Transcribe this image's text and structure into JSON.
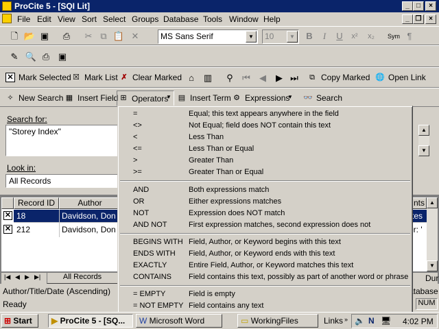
{
  "window": {
    "title": "ProCite 5 - [SQI Lit]"
  },
  "menubar": {
    "items": [
      "File",
      "Edit",
      "View",
      "Sort",
      "Select",
      "Groups",
      "Database",
      "Tools",
      "Window",
      "Help"
    ]
  },
  "format_toolbar": {
    "font_name": "MS Sans Serif",
    "font_size": "10",
    "bold": "B",
    "italic": "I",
    "underline": "U",
    "superscript": "x²",
    "subscript": "x₂",
    "symbol": "Sym",
    "pilcrow": "¶"
  },
  "record_toolbar": {
    "mark_selected": "Mark Selected",
    "mark_list": "Mark List",
    "clear_marked": "Clear Marked",
    "copy_marked": "Copy Marked",
    "open_link": "Open Link"
  },
  "search_toolbar": {
    "new_search": "New Search",
    "insert_field": "Insert Field",
    "operators": "Operators",
    "insert_term": "Insert Term",
    "expressions": "Expressions",
    "search": "Search"
  },
  "search_panel": {
    "search_for_label": "Search for:",
    "search_for_value": "\"Storey Index\"",
    "look_in_label": "Look in:",
    "look_in_value": "All Records"
  },
  "grid": {
    "columns": [
      "Record ID",
      "Author"
    ],
    "right_header_fragment": "nts",
    "rows": [
      {
        "checked": true,
        "id": "18",
        "author": "Davidson, Don",
        "tail": "tes",
        "selected": true
      },
      {
        "checked": true,
        "id": "212",
        "author": "Davidson, Don",
        "tail": "er: '",
        "selected": false
      }
    ],
    "tab_label": "All Records",
    "right_tab_fragment": "Dur"
  },
  "status": {
    "sort_order": "Author/Title/Date (Ascending)",
    "ready": "Ready",
    "database_fragment": "atabase",
    "num": "NUM"
  },
  "operators_menu": {
    "groups": [
      [
        {
          "op": "=",
          "desc": "Equal; this text appears anywhere in the field"
        },
        {
          "op": "<>",
          "desc": "Not Equal; field does NOT contain this text"
        },
        {
          "op": "<",
          "desc": "Less Than"
        },
        {
          "op": "<=",
          "desc": "Less Than or Equal"
        },
        {
          "op": ">",
          "desc": "Greater Than"
        },
        {
          "op": ">=",
          "desc": "Greater Than or Equal"
        }
      ],
      [
        {
          "op": "AND",
          "desc": "Both expressions match"
        },
        {
          "op": "OR",
          "desc": "Either expressions matches"
        },
        {
          "op": "NOT",
          "desc": "Expression does NOT match"
        },
        {
          "op": "AND NOT",
          "desc": "First expression matches, second expression does not"
        }
      ],
      [
        {
          "op": "BEGINS WITH",
          "desc": "Field, Author, or Keyword begins with this text"
        },
        {
          "op": "ENDS WITH",
          "desc": "Field, Author, or Keyword ends with this text"
        },
        {
          "op": "EXACTLY",
          "desc": "Entire Field, Author, or Keyword matches this text"
        },
        {
          "op": "CONTAINS",
          "desc": "Field contains this text, possibly as part of another word or phrase"
        }
      ],
      [
        {
          "op": "= EMPTY",
          "desc": "Field is empty"
        },
        {
          "op": "= NOT EMPTY",
          "desc": "Field contains any text"
        }
      ]
    ]
  },
  "taskbar": {
    "start": "Start",
    "tasks": [
      "ProCite 5 - [SQ...",
      "Microsoft Word",
      "WorkingFiles"
    ],
    "links": "Links",
    "time": "4:02 PM"
  },
  "colors": {
    "titlebar": "#0a246a",
    "selection": "#0a246a",
    "face": "#d4d0c8"
  }
}
